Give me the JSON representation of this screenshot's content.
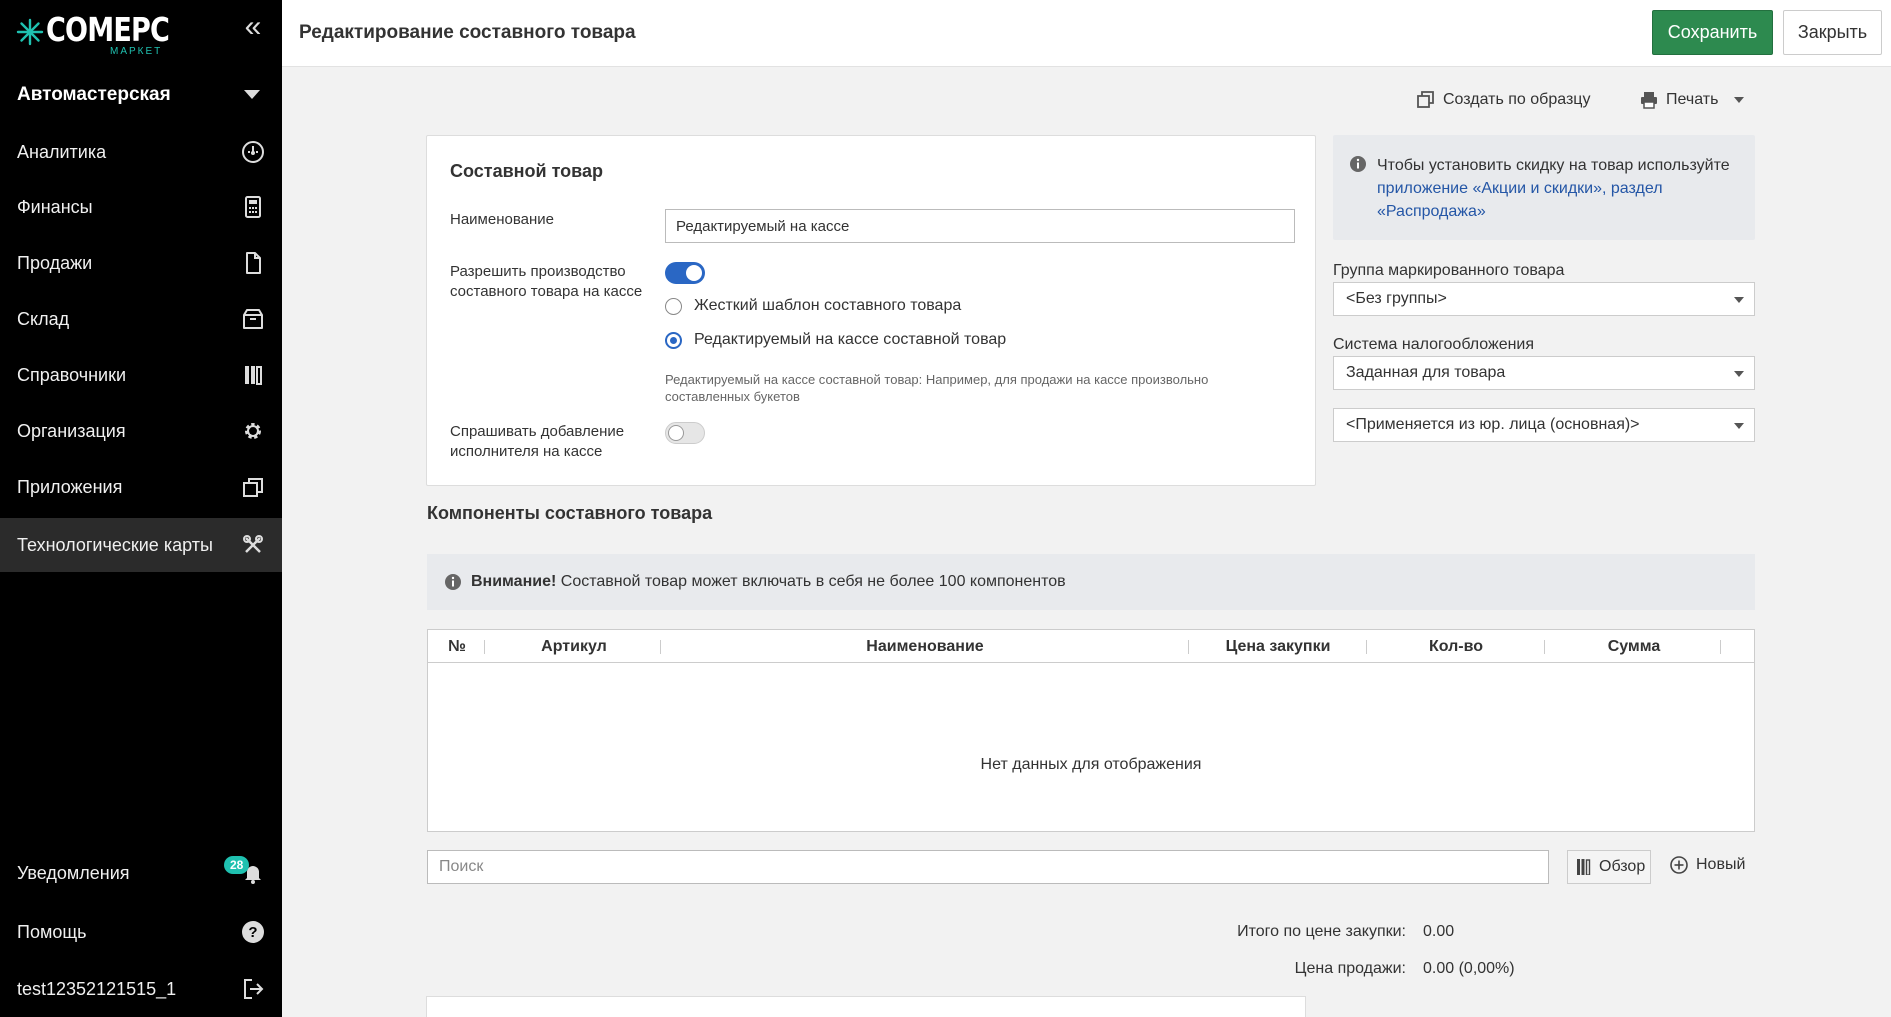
{
  "logo": {
    "word": "COMEPC",
    "sub": "МАРКЕТ"
  },
  "sidebar": {
    "org": "Автомастерская",
    "items": [
      {
        "label": "Аналитика",
        "icon": "analytics-icon"
      },
      {
        "label": "Финансы",
        "icon": "calculator-icon"
      },
      {
        "label": "Продажи",
        "icon": "document-icon"
      },
      {
        "label": "Склад",
        "icon": "box-icon"
      },
      {
        "label": "Справочники",
        "icon": "books-icon"
      },
      {
        "label": "Организация",
        "icon": "gear-icon"
      },
      {
        "label": "Приложения",
        "icon": "apps-icon"
      },
      {
        "label": "Технологические карты",
        "icon": "tools-icon"
      }
    ],
    "notifications": "Уведомления",
    "notifications_count": "28",
    "help": "Помощь",
    "user": "test12352121515_1"
  },
  "header": {
    "title": "Редактирование составного товара",
    "save": "Сохранить",
    "close": "Закрыть"
  },
  "toolbar": {
    "create_copy": "Создать по образцу",
    "print": "Печать"
  },
  "card": {
    "title": "Составной товар",
    "name_label": "Наименование",
    "name_value": "Редактируемый на кассе",
    "allow_label": "Разрешить производство составного товара на кассе",
    "allow_on": true,
    "radio_strict": "Жесткий шаблон составного товара",
    "radio_editable": "Редактируемый на кассе составной товар",
    "hint": "Редактируемый на кассе составной товар: Например, для продажи на кассе произвольно составленных букетов",
    "ask_label": "Спрашивать добавление исполнителя на кассе",
    "ask_on": false
  },
  "info": {
    "text": "Чтобы установить скидку на товар используйте",
    "link": "приложение «Акции и скидки», раздел «Распродажа»"
  },
  "right": {
    "group_label": "Группа маркированного товара",
    "group_value": "<Без группы>",
    "tax_label": "Система налогообложения",
    "tax_value": "Заданная для товара",
    "entity_value": "<Применяется из юр. лица (основная)>"
  },
  "components": {
    "title": "Компоненты составного товара",
    "warn_bold": "Внимание!",
    "warn_text": "Составной товар может включать в себя не более 100 компонентов",
    "columns": [
      "№",
      "Артикул",
      "Наименование",
      "Цена закупки",
      "Кол-во",
      "Сумма"
    ],
    "empty": "Нет данных для отображения",
    "search_placeholder": "Поиск",
    "browse": "Обзор",
    "new": "Новый"
  },
  "totals": {
    "purchase_label": "Итого по цене закупки:",
    "purchase_value": "0.00",
    "sale_label": "Цена продажи:",
    "sale_value": "0.00 (0,00%)"
  }
}
